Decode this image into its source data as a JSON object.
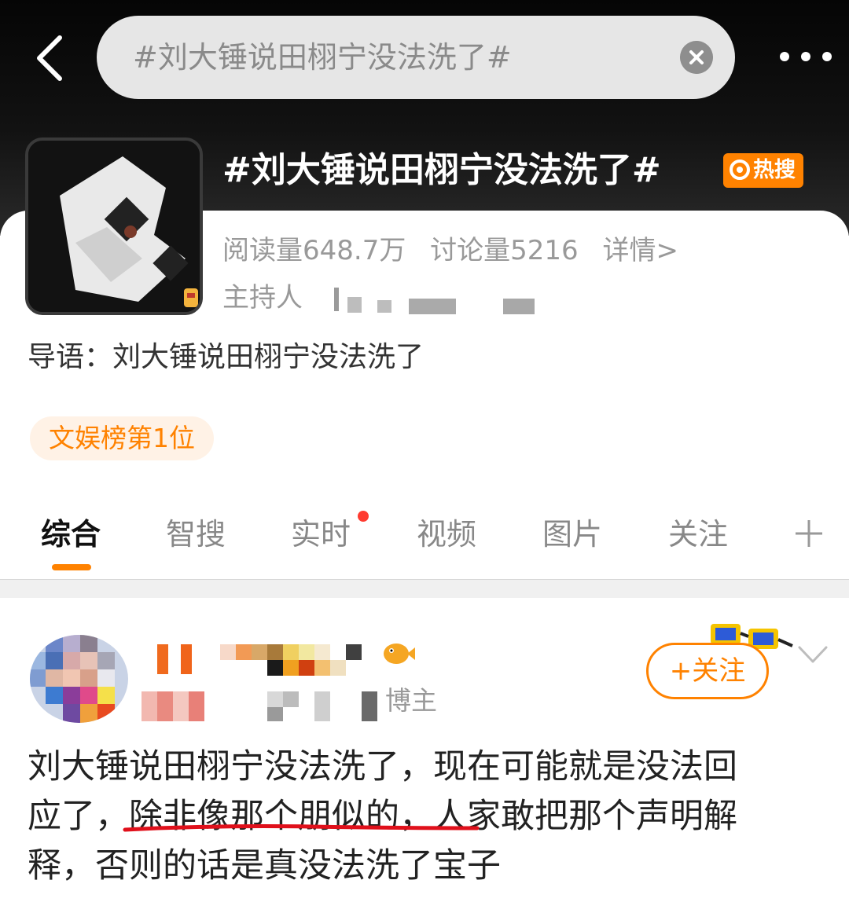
{
  "search": {
    "query": "#刘大锤说田栩宁没法洗了#"
  },
  "topic": {
    "title": "#刘大锤说田栩宁没法洗了#",
    "hot_badge": "热搜",
    "reads": "阅读量648.7万",
    "discussions": "讨论量5216",
    "details": "详情>",
    "host_label": "主持人",
    "intro": "导语：刘大锤说田栩宁没法洗了",
    "rank_tag": "文娱榜第1位"
  },
  "tabs": [
    "综合",
    "智搜",
    "实时",
    "视频",
    "图片",
    "关注"
  ],
  "post": {
    "author_suffix": "博主",
    "follow_label": "+关注",
    "text_lines": [
      "刘大锤说田栩宁没法洗了，现在可能就是没法回",
      "应了，除非像那个朋似的，人家敢把那个声明解",
      "释，否则的话是真没法洗了宝子"
    ]
  },
  "colors": {
    "accent": "#ff8200",
    "notification": "#ff3b30",
    "underline": "#e0101b"
  },
  "icons": [
    "back-arrow-icon",
    "clear-icon",
    "more-icon",
    "hot-icon",
    "plus-icon",
    "chevron-down-icon",
    "fish-badge-icon",
    "sunglasses-sticker-icon"
  ]
}
